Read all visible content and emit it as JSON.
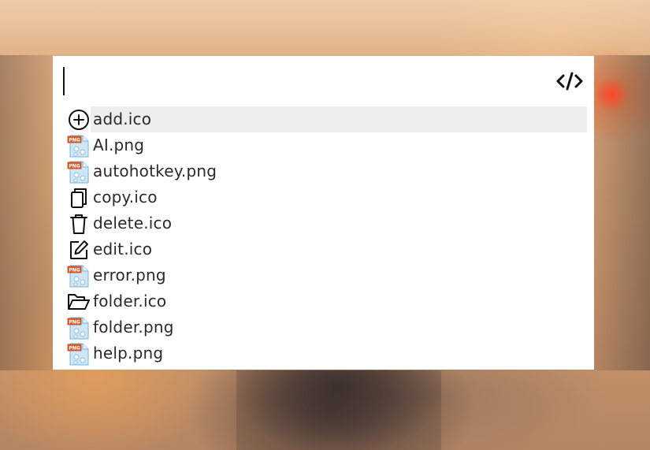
{
  "launcher": {
    "search": {
      "value": "",
      "placeholder": ""
    },
    "code_button_icon": "code-icon",
    "results": [
      {
        "label": "add.ico",
        "icon": "add-icon",
        "selected": true
      },
      {
        "label": "AI.png",
        "icon": "png-file-icon",
        "selected": false
      },
      {
        "label": "autohotkey.png",
        "icon": "png-file-icon",
        "selected": false
      },
      {
        "label": "copy.ico",
        "icon": "copy-icon",
        "selected": false
      },
      {
        "label": "delete.ico",
        "icon": "trash-icon",
        "selected": false
      },
      {
        "label": "edit.ico",
        "icon": "edit-icon",
        "selected": false
      },
      {
        "label": "error.png",
        "icon": "png-file-icon",
        "selected": false
      },
      {
        "label": "folder.ico",
        "icon": "folder-open-icon",
        "selected": false
      },
      {
        "label": "folder.png",
        "icon": "png-file-icon",
        "selected": false
      },
      {
        "label": "help.png",
        "icon": "png-file-icon",
        "selected": false
      }
    ]
  },
  "colors": {
    "panel_background": "#ffffff",
    "selected_row": "#eeeeee",
    "text": "#2a2a2a",
    "png_badge": "#e0632a",
    "png_page": "#bfe0f5"
  }
}
